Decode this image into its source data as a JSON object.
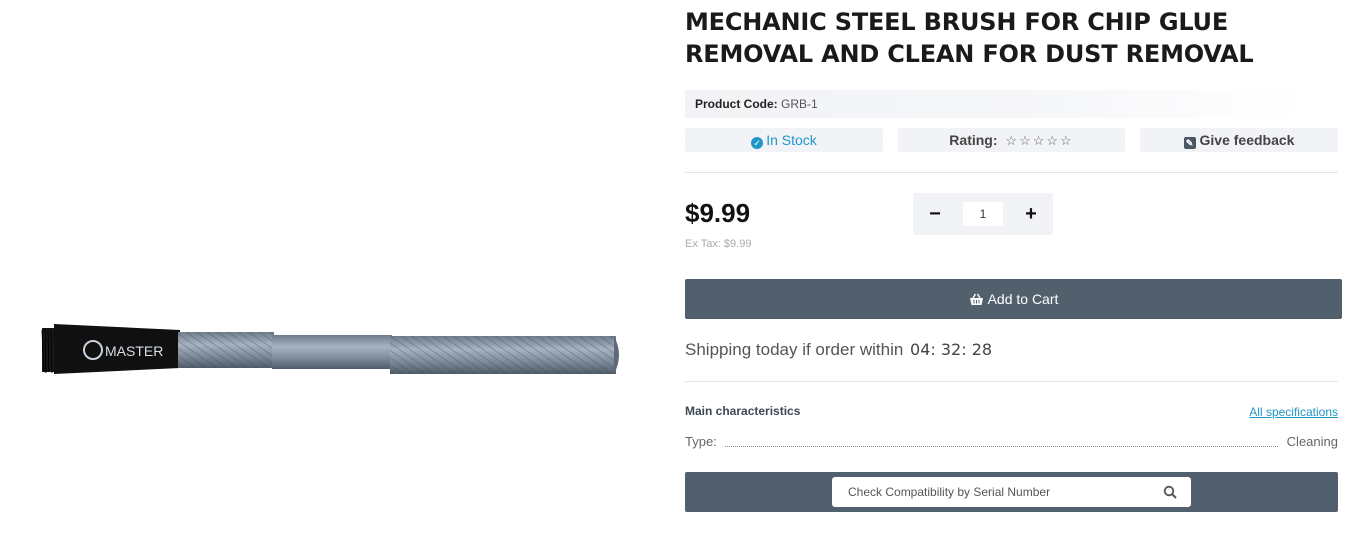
{
  "product": {
    "title": "MECHANIC STEEL BRUSH FOR CHIP GLUE REMOVAL AND CLEAN FOR DUST REMOVAL",
    "code_label": "Product Code:",
    "code_value": "GRB-1",
    "image_brand": "MASTER",
    "image_icon": "product-brush-image"
  },
  "meta": {
    "stock": "In Stock",
    "rating_label": "Rating:",
    "rating_value": 0,
    "rating_max": 5,
    "feedback": "Give feedback"
  },
  "pricing": {
    "price": "$9.99",
    "ex_tax": "Ex Tax: $9.99"
  },
  "quantity": {
    "minus": "−",
    "value": "1",
    "plus": "+"
  },
  "cart": {
    "label": "Add to Cart",
    "icon": "basket-icon"
  },
  "shipping": {
    "text": "Shipping today if order within",
    "countdown": "04: 32: 28"
  },
  "specs": {
    "title": "Main characteristics",
    "link": "All specifications",
    "rows": [
      {
        "name": "Type:",
        "value": "Cleaning"
      }
    ]
  },
  "compat": {
    "placeholder": "Check Compatibility by Serial Number",
    "icon": "search-icon"
  },
  "colors": {
    "dark_bar": "#525f6c",
    "accent": "#2196c9",
    "light_bg": "#f1f3f6"
  }
}
